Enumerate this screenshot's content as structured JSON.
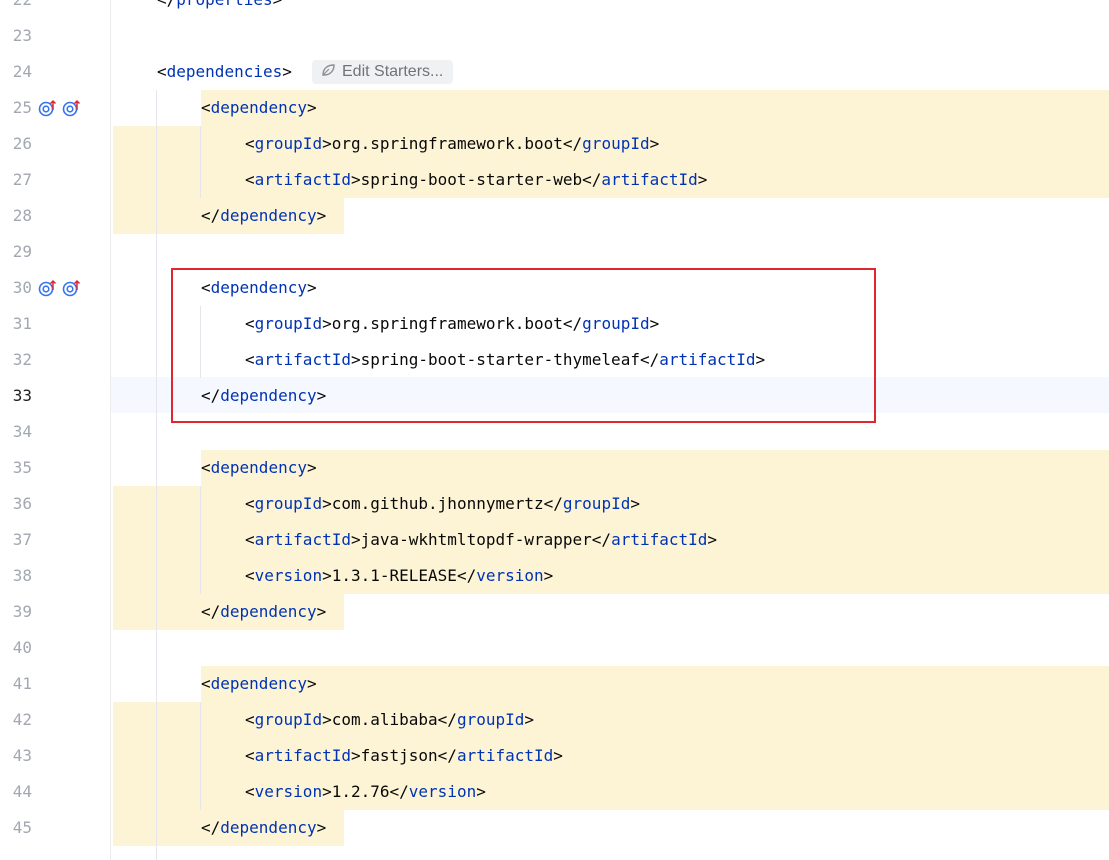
{
  "editor": {
    "top_line_partial": "22",
    "top_code_partial": "</properties>",
    "inlay": {
      "label": "Edit Starters...",
      "icon": "spring-leaf-icon"
    },
    "gutter_icon": "maven-override-icon",
    "current_line": "33",
    "lines": [
      {
        "num": "23",
        "code": ""
      },
      {
        "num": "24",
        "code": "<dependencies>"
      },
      {
        "num": "25",
        "code": "<dependency>"
      },
      {
        "num": "26",
        "code": "<groupId>org.springframework.boot</groupId>"
      },
      {
        "num": "27",
        "code": "<artifactId>spring-boot-starter-web</artifactId>"
      },
      {
        "num": "28",
        "code": "</dependency>"
      },
      {
        "num": "29",
        "code": ""
      },
      {
        "num": "30",
        "code": "<dependency>"
      },
      {
        "num": "31",
        "code": "<groupId>org.springframework.boot</groupId>"
      },
      {
        "num": "32",
        "code": "<artifactId>spring-boot-starter-thymeleaf</artifactId>"
      },
      {
        "num": "33",
        "code": "</dependency>"
      },
      {
        "num": "34",
        "code": ""
      },
      {
        "num": "35",
        "code": "<dependency>"
      },
      {
        "num": "36",
        "code": "<groupId>com.github.jhonnymertz</groupId>"
      },
      {
        "num": "37",
        "code": "<artifactId>java-wkhtmltopdf-wrapper</artifactId>"
      },
      {
        "num": "38",
        "code": "<version>1.3.1-RELEASE</version>"
      },
      {
        "num": "39",
        "code": "</dependency>"
      },
      {
        "num": "40",
        "code": ""
      },
      {
        "num": "41",
        "code": "<dependency>"
      },
      {
        "num": "42",
        "code": "<groupId>com.alibaba</groupId>"
      },
      {
        "num": "43",
        "code": "<artifactId>fastjson</artifactId>"
      },
      {
        "num": "44",
        "code": "<version>1.2.76</version>"
      },
      {
        "num": "45",
        "code": "</dependency>"
      }
    ]
  },
  "colors": {
    "tag": "#0033b3",
    "text": "#080808",
    "highlight": "#fdf4d6",
    "selection_box": "#e0262f"
  }
}
